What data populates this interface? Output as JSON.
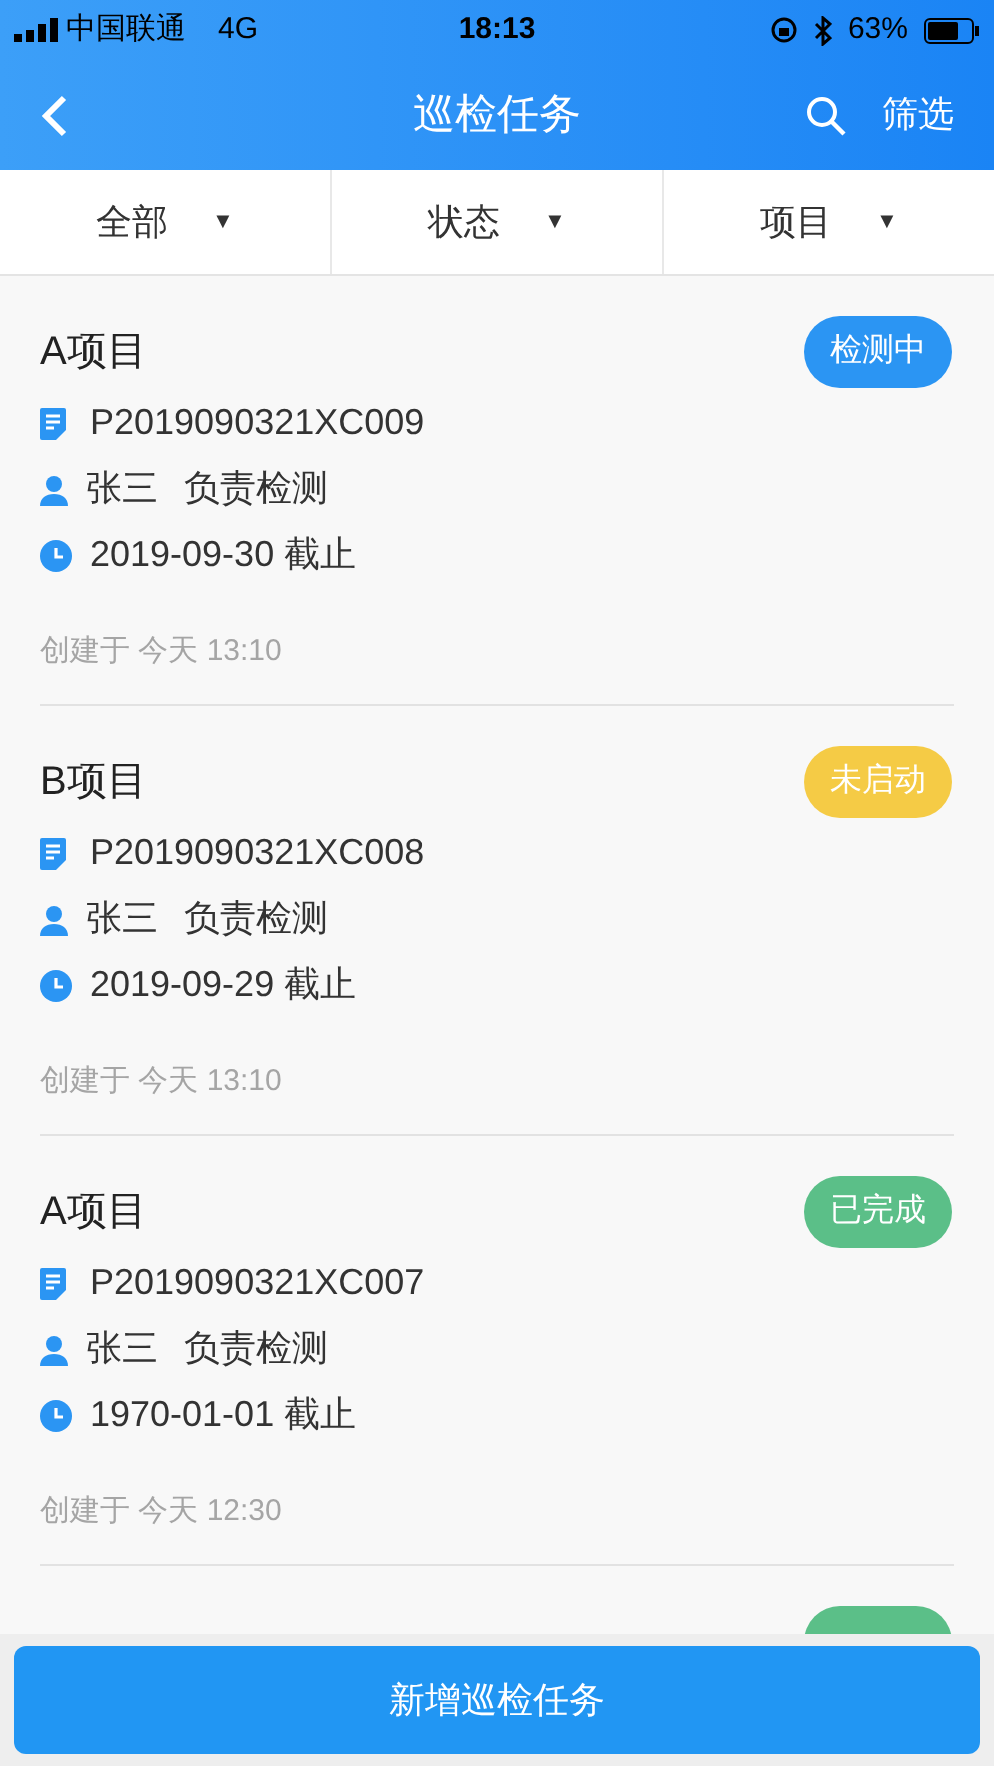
{
  "status_bar": {
    "carrier": "中国联通",
    "network": "4G",
    "time": "18:13",
    "battery": "63%"
  },
  "nav": {
    "title": "巡检任务",
    "filter": "筛选"
  },
  "filters": [
    {
      "label": "全部",
      "arrow": "▼"
    },
    {
      "label": "状态",
      "arrow": "▼"
    },
    {
      "label": "项目",
      "arrow": "▼"
    }
  ],
  "tasks": [
    {
      "project": "A项目",
      "status": "检测中",
      "color": "#2b95f3",
      "code": "P2019090321XC009",
      "person": "张三",
      "role": "负责检测",
      "deadline": "2019-09-30 截止",
      "created": "创建于 今天 13:10"
    },
    {
      "project": "B项目",
      "status": "未启动",
      "color": "#f5cb45",
      "code": "P2019090321XC008",
      "person": "张三",
      "role": "负责检测",
      "deadline": "2019-09-29 截止",
      "created": "创建于 今天 13:10"
    },
    {
      "project": "A项目",
      "status": "已完成",
      "color": "#5bbf88",
      "code": "P2019090321XC007",
      "person": "张三",
      "role": "负责检测",
      "deadline": "1970-01-01 截止",
      "created": "创建于 今天 12:30"
    },
    {
      "color": "#5bbf88"
    }
  ],
  "add_button": "新增巡检任务"
}
